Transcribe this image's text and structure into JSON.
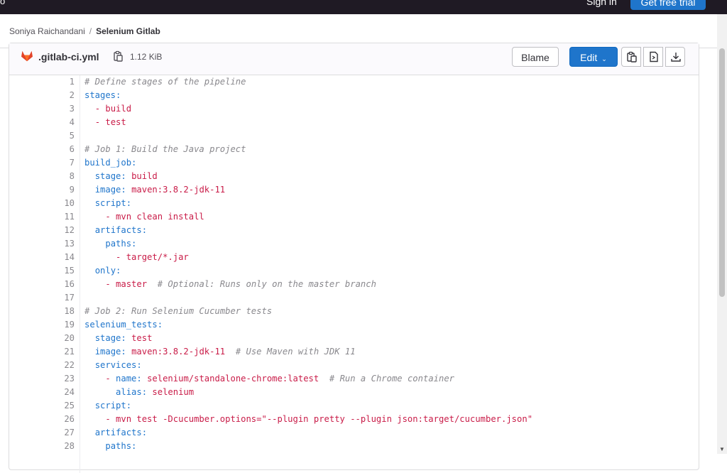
{
  "topbar": {
    "left_edge_text": "o",
    "signin_label": "Sign in",
    "trial_label": "Get free trial"
  },
  "breadcrumb": {
    "owner": "Soniya Raichandani",
    "separator": "/",
    "project": "Selenium Gitlab"
  },
  "file": {
    "name": ".gitlab-ci.yml",
    "size": "1.12 KiB",
    "blame_label": "Blame",
    "edit_label": "Edit",
    "edit_caret": "⌄",
    "icons": [
      "gitlab-fox-icon",
      "copy-path-icon",
      "copy-contents-icon",
      "open-raw-icon",
      "download-icon"
    ]
  },
  "colors": {
    "comment": "#89888d",
    "key": "#1f75cb",
    "string": "#c91c48",
    "primary_button": "#1f75cb"
  },
  "code_lines": [
    {
      "n": "1",
      "tokens": [
        [
          "c",
          "# Define stages of the pipeline"
        ]
      ]
    },
    {
      "n": "2",
      "tokens": [
        [
          "k",
          "stages"
        ],
        [
          "k",
          ":"
        ]
      ]
    },
    {
      "n": "3",
      "tokens": [
        [
          "p",
          "  "
        ],
        [
          "s",
          "- build"
        ]
      ]
    },
    {
      "n": "4",
      "tokens": [
        [
          "p",
          "  "
        ],
        [
          "s",
          "- test"
        ]
      ]
    },
    {
      "n": "5",
      "tokens": []
    },
    {
      "n": "6",
      "tokens": [
        [
          "c",
          "# Job 1: Build the Java project"
        ]
      ]
    },
    {
      "n": "7",
      "tokens": [
        [
          "k",
          "build_job:"
        ]
      ]
    },
    {
      "n": "8",
      "tokens": [
        [
          "p",
          "  "
        ],
        [
          "k",
          "stage: "
        ],
        [
          "s",
          "build"
        ]
      ]
    },
    {
      "n": "9",
      "tokens": [
        [
          "p",
          "  "
        ],
        [
          "k",
          "image: "
        ],
        [
          "s",
          "maven:3.8.2-jdk-11"
        ]
      ]
    },
    {
      "n": "10",
      "tokens": [
        [
          "p",
          "  "
        ],
        [
          "k",
          "script:"
        ]
      ]
    },
    {
      "n": "11",
      "tokens": [
        [
          "p",
          "    "
        ],
        [
          "s",
          "- mvn clean install"
        ]
      ]
    },
    {
      "n": "12",
      "tokens": [
        [
          "p",
          "  "
        ],
        [
          "k",
          "artifacts:"
        ]
      ]
    },
    {
      "n": "13",
      "tokens": [
        [
          "p",
          "    "
        ],
        [
          "k",
          "paths:"
        ]
      ]
    },
    {
      "n": "14",
      "tokens": [
        [
          "p",
          "      "
        ],
        [
          "s",
          "- target/*.jar"
        ]
      ]
    },
    {
      "n": "15",
      "tokens": [
        [
          "p",
          "  "
        ],
        [
          "k",
          "only:"
        ]
      ]
    },
    {
      "n": "16",
      "tokens": [
        [
          "p",
          "    "
        ],
        [
          "s",
          "- master"
        ],
        [
          "p",
          "  "
        ],
        [
          "c",
          "# Optional: Runs only on the master branch"
        ]
      ]
    },
    {
      "n": "17",
      "tokens": []
    },
    {
      "n": "18",
      "tokens": [
        [
          "c",
          "# Job 2: Run Selenium Cucumber tests"
        ]
      ]
    },
    {
      "n": "19",
      "tokens": [
        [
          "k",
          "selenium_tests:"
        ]
      ]
    },
    {
      "n": "20",
      "tokens": [
        [
          "p",
          "  "
        ],
        [
          "k",
          "stage: "
        ],
        [
          "s",
          "test"
        ]
      ]
    },
    {
      "n": "21",
      "tokens": [
        [
          "p",
          "  "
        ],
        [
          "k",
          "image: "
        ],
        [
          "s",
          "maven:3.8.2-jdk-11"
        ],
        [
          "p",
          "  "
        ],
        [
          "c",
          "# Use Maven with JDK 11"
        ]
      ]
    },
    {
      "n": "22",
      "tokens": [
        [
          "p",
          "  "
        ],
        [
          "k",
          "services:"
        ]
      ]
    },
    {
      "n": "23",
      "tokens": [
        [
          "p",
          "    "
        ],
        [
          "s",
          "- "
        ],
        [
          "k",
          "name: "
        ],
        [
          "s",
          "selenium/standalone-chrome:latest"
        ],
        [
          "p",
          "  "
        ],
        [
          "c",
          "# Run a Chrome container"
        ]
      ]
    },
    {
      "n": "24",
      "tokens": [
        [
          "p",
          "      "
        ],
        [
          "k",
          "alias: "
        ],
        [
          "s",
          "selenium"
        ]
      ]
    },
    {
      "n": "25",
      "tokens": [
        [
          "p",
          "  "
        ],
        [
          "k",
          "script:"
        ]
      ]
    },
    {
      "n": "26",
      "tokens": [
        [
          "p",
          "    "
        ],
        [
          "s",
          "- mvn test -Dcucumber.options=\"--plugin pretty --plugin json:target/cucumber.json\""
        ]
      ]
    },
    {
      "n": "27",
      "tokens": [
        [
          "p",
          "  "
        ],
        [
          "k",
          "artifacts:"
        ]
      ]
    },
    {
      "n": "28",
      "tokens": [
        [
          "p",
          "    "
        ],
        [
          "k",
          "paths:"
        ]
      ]
    }
  ]
}
